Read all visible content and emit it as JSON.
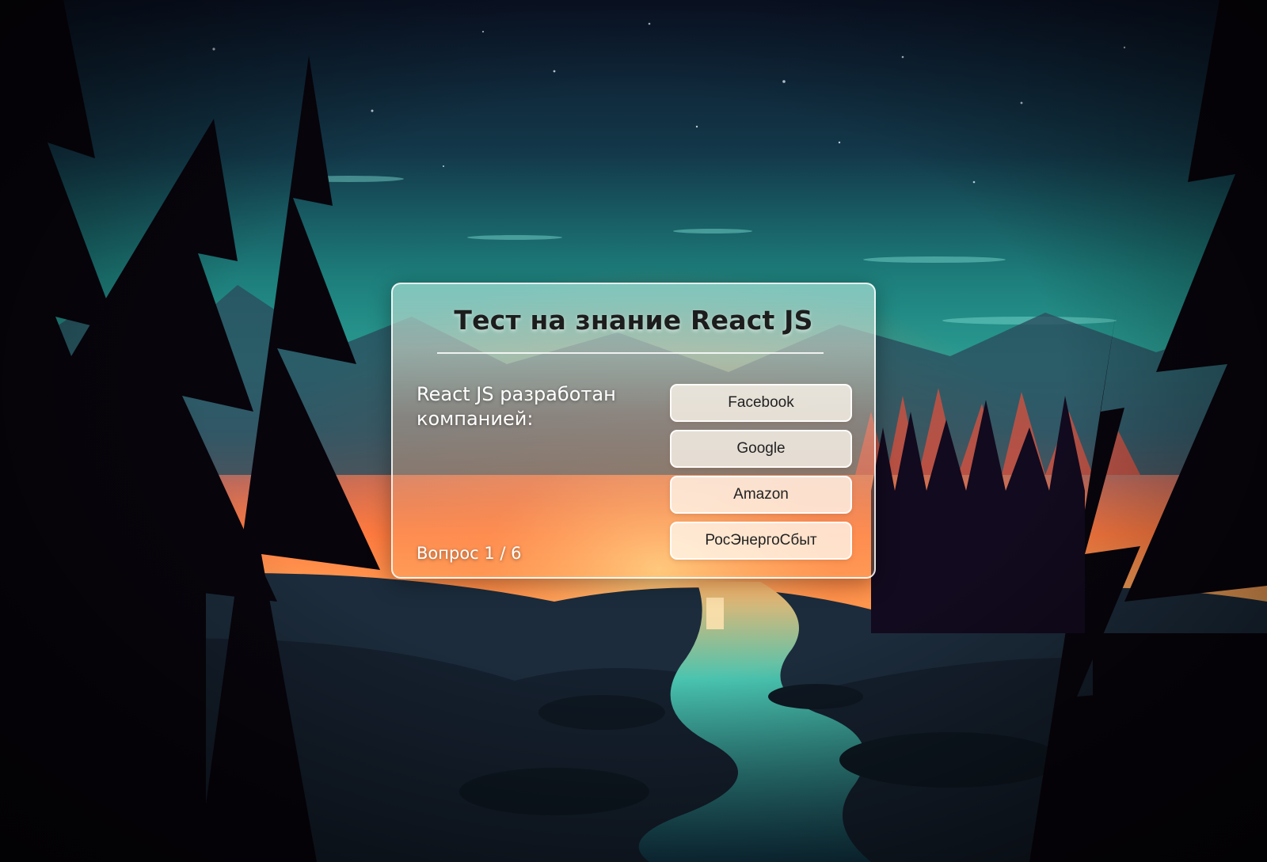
{
  "quiz": {
    "title": "Тест на знание React JS",
    "question": "React JS разработан компанией:",
    "progress": "Вопрос 1 / 6",
    "answers": [
      "Facebook",
      "Google",
      "Amazon",
      "РосЭнергоСбыт"
    ]
  },
  "background": {
    "scene": "forest-river-sunset",
    "colors": {
      "sky_top": "#0b1a2e",
      "sky_teal": "#1f8f88",
      "horizon_glow": "#ff6a3c",
      "river": "#2fb3a3",
      "trees": "#0a0612"
    }
  }
}
